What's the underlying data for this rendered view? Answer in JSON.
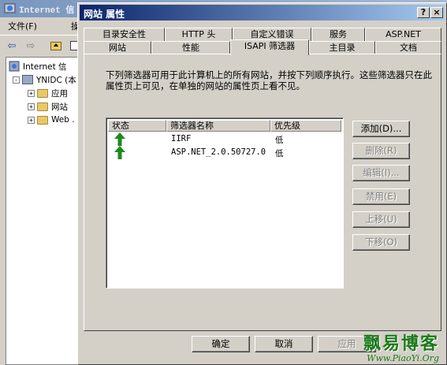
{
  "background_window": {
    "title": "Internet 信",
    "menu": [
      "文件(F)",
      "操"
    ],
    "tree": [
      {
        "label": "Internet 信",
        "level": 0,
        "expander": ""
      },
      {
        "label": "YNIDC (本",
        "level": 1,
        "expander": "-"
      },
      {
        "label": "应用",
        "level": 2,
        "expander": "+"
      },
      {
        "label": "网站",
        "level": 2,
        "expander": "+"
      },
      {
        "label": "Web .",
        "level": 2,
        "expander": "+"
      }
    ]
  },
  "dialog": {
    "title": "网站 属性",
    "title_buttons": {
      "help": "?",
      "close": "×"
    },
    "tabs_back": [
      "目录安全性",
      "HTTP 头",
      "自定义错误",
      "服务",
      "ASP.NET"
    ],
    "tabs_front": [
      "网站",
      "性能",
      "ISAPI 筛选器",
      "主目录",
      "文档"
    ],
    "active_tab": "ISAPI 筛选器",
    "description": "下列筛选器可用于此计算机上的所有网站，并按下列顺序执行。这些筛选器只在此属性页上可见，在单独的网站的属性页上看不见。",
    "list": {
      "columns": [
        "状态",
        "筛选器名称",
        "优先级"
      ],
      "rows": [
        {
          "status": "loaded-up-arrow",
          "name": "IIRF",
          "priority": "低"
        },
        {
          "status": "loaded-up-arrow",
          "name": "ASP.NET_2.0.50727.0",
          "priority": "低"
        }
      ]
    },
    "side_buttons": [
      {
        "label": "添加(D)...",
        "enabled": true
      },
      {
        "label": "删除(R)",
        "enabled": false
      },
      {
        "label": "编辑(I)...",
        "enabled": false
      },
      {
        "label": "禁用(E)",
        "enabled": false
      },
      {
        "label": "上移(U)",
        "enabled": false
      },
      {
        "label": "下移(O)",
        "enabled": false
      }
    ],
    "footer_buttons": {
      "ok": "确定",
      "cancel": "取消",
      "apply": "应用"
    }
  },
  "watermark": {
    "title": "飘易博客",
    "url": "Www.PiaoYi.Org"
  },
  "colors": {
    "title_active": "#0a246a",
    "face": "#d4d0c8",
    "arrow": "#1e8a1e",
    "watermark": "#1a7a1a"
  }
}
